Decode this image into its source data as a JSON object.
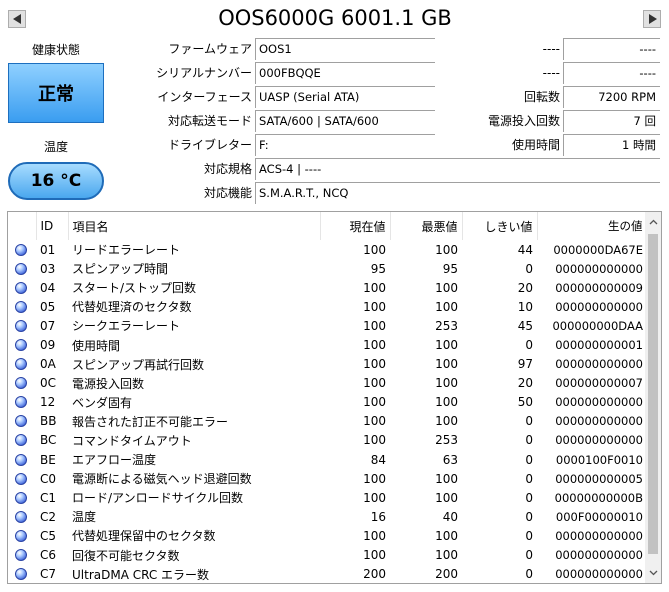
{
  "header": {
    "title": "OOS6000G 6001.1 GB"
  },
  "health": {
    "label": "健康状態",
    "status": "正常"
  },
  "temperature": {
    "label": "温度",
    "value": "16 °C"
  },
  "info": [
    {
      "label": "ファームウェア",
      "value": "OOS1"
    },
    {
      "label": "シリアルナンバー",
      "value": "000FBQQE"
    },
    {
      "label": "インターフェース",
      "value": "UASP (Serial ATA)"
    },
    {
      "label": "対応転送モード",
      "value": "SATA/600 | SATA/600"
    },
    {
      "label": "ドライブレター",
      "value": "F:"
    },
    {
      "label": "対応規格",
      "value": "ACS-4 | ----"
    },
    {
      "label": "対応機能",
      "value": "S.M.A.R.T., NCQ"
    }
  ],
  "right_info": [
    {
      "label": "----",
      "value": "----"
    },
    {
      "label": "----",
      "value": "----"
    },
    {
      "label": "回転数",
      "value": "7200 RPM"
    },
    {
      "label": "電源投入回数",
      "value": "7 回"
    },
    {
      "label": "使用時間",
      "value": "1 時間"
    }
  ],
  "table": {
    "columns": [
      "ID",
      "項目名",
      "現在値",
      "最悪値",
      "しきい値",
      "生の値"
    ],
    "rows": [
      {
        "id": "01",
        "name": "リードエラーレート",
        "current": "100",
        "worst": "100",
        "threshold": "44",
        "raw": "0000000DA67E"
      },
      {
        "id": "03",
        "name": "スピンアップ時間",
        "current": "95",
        "worst": "95",
        "threshold": "0",
        "raw": "000000000000"
      },
      {
        "id": "04",
        "name": "スタート/ストップ回数",
        "current": "100",
        "worst": "100",
        "threshold": "20",
        "raw": "000000000009"
      },
      {
        "id": "05",
        "name": "代替処理済のセクタ数",
        "current": "100",
        "worst": "100",
        "threshold": "10",
        "raw": "000000000000"
      },
      {
        "id": "07",
        "name": "シークエラーレート",
        "current": "100",
        "worst": "253",
        "threshold": "45",
        "raw": "000000000DAA"
      },
      {
        "id": "09",
        "name": "使用時間",
        "current": "100",
        "worst": "100",
        "threshold": "0",
        "raw": "000000000001"
      },
      {
        "id": "0A",
        "name": "スピンアップ再試行回数",
        "current": "100",
        "worst": "100",
        "threshold": "97",
        "raw": "000000000000"
      },
      {
        "id": "0C",
        "name": "電源投入回数",
        "current": "100",
        "worst": "100",
        "threshold": "20",
        "raw": "000000000007"
      },
      {
        "id": "12",
        "name": "ベンダ固有",
        "current": "100",
        "worst": "100",
        "threshold": "50",
        "raw": "000000000000"
      },
      {
        "id": "BB",
        "name": "報告された訂正不可能エラー",
        "current": "100",
        "worst": "100",
        "threshold": "0",
        "raw": "000000000000"
      },
      {
        "id": "BC",
        "name": "コマンドタイムアウト",
        "current": "100",
        "worst": "253",
        "threshold": "0",
        "raw": "000000000000"
      },
      {
        "id": "BE",
        "name": "エアフロー温度",
        "current": "84",
        "worst": "63",
        "threshold": "0",
        "raw": "0000100F0010"
      },
      {
        "id": "C0",
        "name": "電源断による磁気ヘッド退避回数",
        "current": "100",
        "worst": "100",
        "threshold": "0",
        "raw": "000000000005"
      },
      {
        "id": "C1",
        "name": "ロード/アンロードサイクル回数",
        "current": "100",
        "worst": "100",
        "threshold": "0",
        "raw": "00000000000B"
      },
      {
        "id": "C2",
        "name": "温度",
        "current": "16",
        "worst": "40",
        "threshold": "0",
        "raw": "000F00000010"
      },
      {
        "id": "C5",
        "name": "代替処理保留中のセクタ数",
        "current": "100",
        "worst": "100",
        "threshold": "0",
        "raw": "000000000000"
      },
      {
        "id": "C6",
        "name": "回復不可能セクタ数",
        "current": "100",
        "worst": "100",
        "threshold": "0",
        "raw": "000000000000"
      },
      {
        "id": "C7",
        "name": "UltraDMA CRC エラー数",
        "current": "200",
        "worst": "200",
        "threshold": "0",
        "raw": "000000000000"
      }
    ]
  }
}
